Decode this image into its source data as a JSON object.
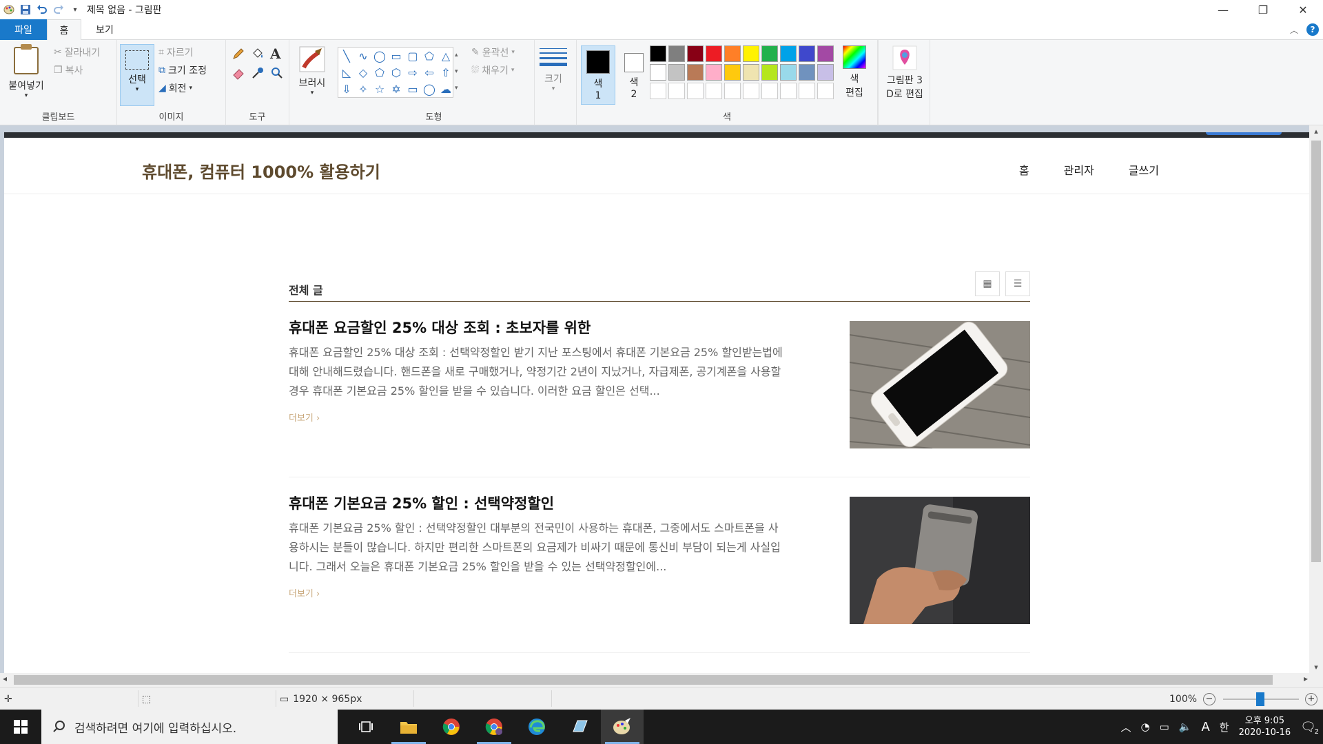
{
  "window": {
    "title": "제목 없음 - 그림판",
    "controls": {
      "minimize": "—",
      "maximize": "❐",
      "close": "✕"
    }
  },
  "menu": {
    "file": "파일",
    "home": "홈",
    "view": "보기"
  },
  "ribbon": {
    "clipboard": {
      "label": "클립보드",
      "paste": "붙여넣기",
      "cut": "잘라내기",
      "copy": "복사"
    },
    "image": {
      "label": "이미지",
      "select": "선택",
      "crop": "자르기",
      "resize": "크기 조정",
      "rotate": "회전"
    },
    "tools": {
      "label": "도구"
    },
    "brushes": {
      "label": "브러시"
    },
    "shapes": {
      "label": "도형",
      "outline": "윤곽선",
      "fill": "채우기"
    },
    "size": {
      "label": "크기"
    },
    "colors": {
      "label": "색",
      "color1_top": "색",
      "color1_bottom": "1",
      "color2_top": "색",
      "color2_bottom": "2",
      "edit_top": "색",
      "edit_bottom": "편집",
      "paint3d_top": "그림판 3",
      "paint3d_bottom": "D로 편집",
      "color1_value": "#000000",
      "color2_value": "#ffffff",
      "palette": [
        "#000000",
        "#7f7f7f",
        "#880015",
        "#ed1c24",
        "#ff7f27",
        "#fff200",
        "#22b14c",
        "#00a2e8",
        "#3f48cc",
        "#a349a4",
        "#ffffff",
        "#c3c3c3",
        "#b97a57",
        "#ffaec9",
        "#ffc90e",
        "#efe4b0",
        "#b5e61d",
        "#99d9ea",
        "#7092be",
        "#c8bfe7"
      ]
    }
  },
  "blog": {
    "site_title": "휴대폰, 컴퓨터 1000% 활용하기",
    "nav": [
      "홈",
      "관리자",
      "글쓰기"
    ],
    "list_label": "전체 글",
    "posts": [
      {
        "title": "휴대폰 요금할인 25% 대상 조회 : 초보자를 위한",
        "excerpt": "휴대폰 요금할인 25% 대상 조회 : 선택약정할인 받기 지난 포스팅에서 휴대폰 기본요금 25% 할인받는법에 대해 안내해드렸습니다. 핸드폰을 새로 구매했거나, 약정기간 2년이 지났거나, 자급제폰, 공기계폰을 사용할 경우 휴대폰 기본요금 25% 할인을 받을 수 있습니다. 이러한 요금 할인은 선택...",
        "more": "더보기"
      },
      {
        "title": "휴대폰 기본요금 25% 할인 : 선택약정할인",
        "excerpt": "휴대폰 기본요금 25% 할인 : 선택약정할인 대부분의 전국민이 사용하는 휴대폰, 그중에서도 스마트폰을 사용하시는 분들이 많습니다. 하지만 편리한 스마트폰의 요금제가 비싸기 때문에 통신비 부담이 되는게 사실입니다. 그래서 오늘은 휴대폰 기본요금 25% 할인을 받을 수 있는 선택약정할인에...",
        "more": "더보기"
      }
    ]
  },
  "status": {
    "dimensions": "1920 × 965px",
    "zoom": "100%"
  },
  "taskbar": {
    "search_placeholder": "검색하려면 여기에 입력하십시오.",
    "ime_a": "A",
    "ime_han": "한",
    "time": "오후 9:05",
    "date": "2020-10-16",
    "notifications": "2"
  }
}
